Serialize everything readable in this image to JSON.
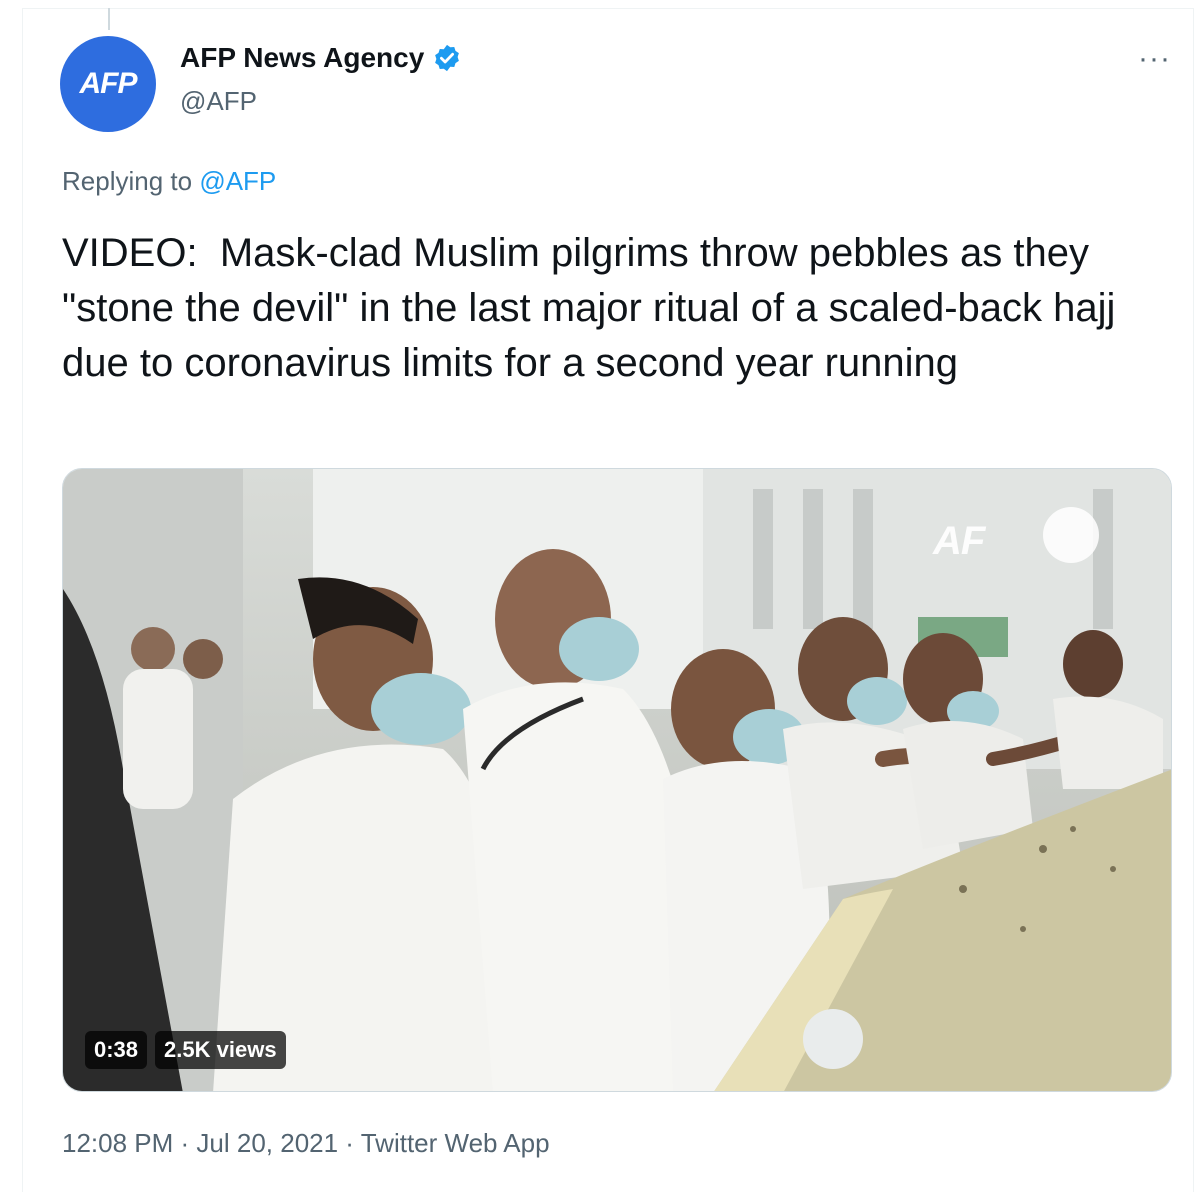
{
  "author": {
    "avatar_text": "AFP",
    "display_name": "AFP News Agency",
    "handle": "@AFP",
    "verified": true
  },
  "reply": {
    "prefix": "Replying to ",
    "mention": "@AFP"
  },
  "tweet": {
    "text": "VIDEO:  Mask-clad Muslim pilgrims throw pebbles as they \"stone the devil\" in the last major ritual of a scaled-back hajj due to coronavirus limits for a second year running"
  },
  "video": {
    "watermark": "AF",
    "duration": "0:38",
    "views": "2.5K views"
  },
  "meta": {
    "time": "12:08 PM",
    "sep1": " · ",
    "date": "Jul 20, 2021",
    "sep2": " · ",
    "source": "Twitter Web App"
  },
  "menu": {
    "more_label": "···"
  },
  "colors": {
    "accent": "#1d9bf0",
    "avatar_bg": "#2e6ddf",
    "secondary_text": "#536471",
    "primary_text": "#0f1419"
  }
}
